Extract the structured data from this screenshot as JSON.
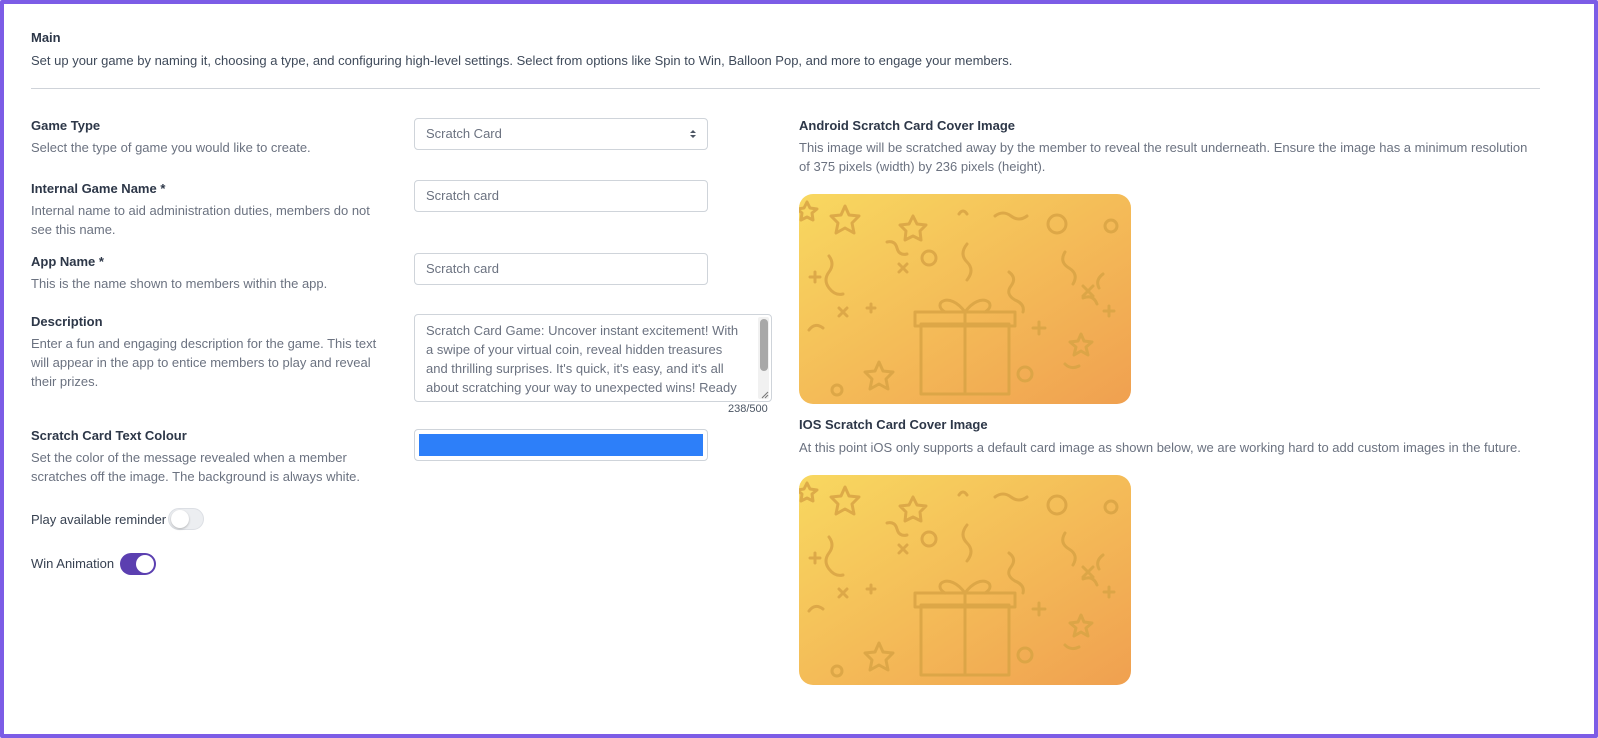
{
  "main": {
    "title": "Main",
    "description": "Set up your game by naming it, choosing a type, and configuring high-level settings. Select from options like Spin to Win, Balloon Pop, and more to engage your members."
  },
  "game_type": {
    "label": "Game Type",
    "help": "Select the type of game you would like to create.",
    "selected": "Scratch Card"
  },
  "internal_name": {
    "label": "Internal Game Name *",
    "help": "Internal name to aid administration duties, members do not see this name.",
    "value": "Scratch card"
  },
  "app_name": {
    "label": "App Name *",
    "help": "This is the name shown to members within the app.",
    "value": "Scratch card"
  },
  "description": {
    "label": "Description",
    "help": "Enter a fun and engaging description for the game. This text will appear in the app to entice members to play and reveal their prizes.",
    "value": "Scratch Card Game: Uncover instant excitement! With a swipe of your virtual coin, reveal hidden treasures and thrilling surprises. It's quick, it's easy, and it's all about scratching your way to unexpected wins! Ready to scratch and win?",
    "counter": "238/500"
  },
  "text_colour": {
    "label": "Scratch Card Text Colour",
    "help": "Set the color of the message revealed when a member scratches off the image. The background is always white.",
    "color": "#2d7ff9"
  },
  "play_reminder": {
    "label": "Play available reminder",
    "enabled": false
  },
  "win_animation": {
    "label": "Win Animation",
    "enabled": true
  },
  "android_cover": {
    "label": "Android Scratch Card Cover Image",
    "help": "This image will be scratched away by the member to reveal the result underneath. Ensure the image has a minimum resolution of 375 pixels (width) by 236 pixels (height)."
  },
  "ios_cover": {
    "label": "IOS Scratch Card Cover Image",
    "help": "At this point iOS only supports a default card image as shown below, we are working hard to add custom images in the future."
  },
  "colors": {
    "frame": "#7c5ce6",
    "toggle_on": "#5b3fb0",
    "card_gradient_start": "#f8d860",
    "card_gradient_end": "#f0a050"
  }
}
